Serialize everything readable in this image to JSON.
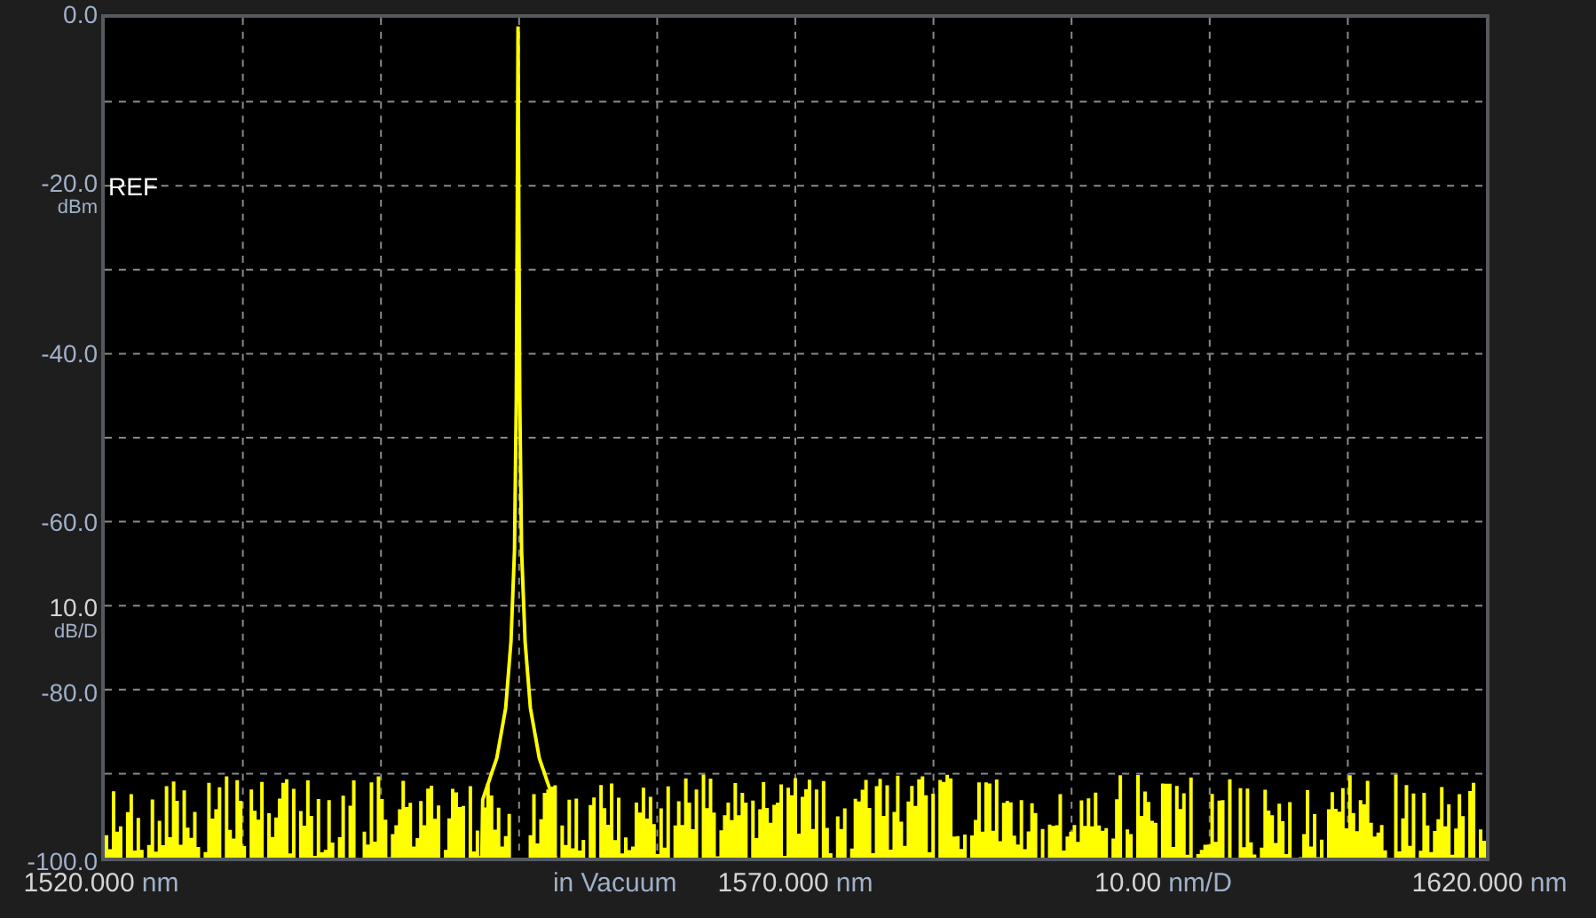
{
  "y_axis": {
    "ticks": [
      {
        "text": "0.0"
      },
      {
        "text": "-20.0",
        "marker": "REF",
        "unit": "dBm"
      },
      {
        "text": "-40.0"
      },
      {
        "text": "-60.0"
      },
      {
        "text": "-80.0"
      },
      {
        "text": "-100.0"
      }
    ],
    "scale": {
      "value": "10.0",
      "unit": "dB/D"
    }
  },
  "x_axis": {
    "start": {
      "value": "1520.000",
      "unit": "nm"
    },
    "medium": "in Vacuum",
    "center": {
      "value": "1570.000",
      "unit": "nm"
    },
    "span": {
      "value": "10.00",
      "unit": "nm/D"
    },
    "stop": {
      "value": "1620.000",
      "unit": "nm"
    }
  }
}
